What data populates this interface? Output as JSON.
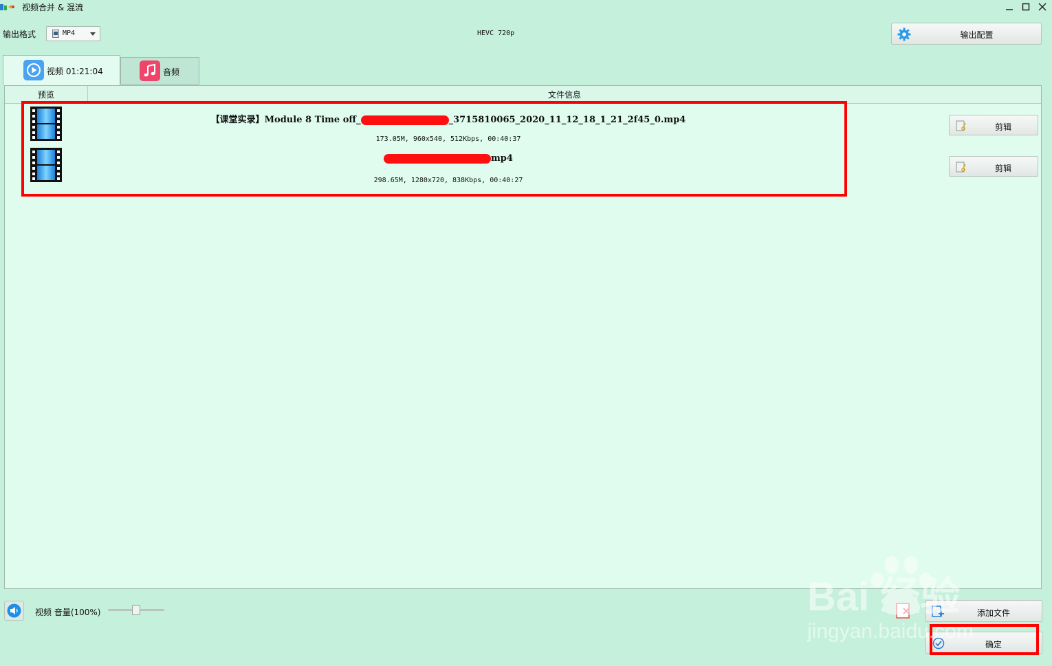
{
  "window": {
    "title": "视频合并 & 混流"
  },
  "toolbar": {
    "format_label": "输出格式",
    "format_value": "MP4",
    "codec_info": "HEVC 720p",
    "output_config_label": "输出配置"
  },
  "tabs": [
    {
      "label": "视频 01:21:04"
    },
    {
      "label": "音频"
    }
  ],
  "table": {
    "columns": [
      "预览",
      "文件信息"
    ],
    "rows": [
      {
        "name_prefix": "【课堂实录】Module 8 Time off_",
        "name_suffix": "_3715810065_2020_11_12_18_1_21_2f45_0.mp4",
        "details": "173.05M, 960x540, 512Kbps, 00:40:37",
        "trim_label": "剪辑"
      },
      {
        "name_prefix": "",
        "name_suffix": "mp4",
        "details": "298.65M, 1280x720, 838Kbps, 00:40:27",
        "trim_label": "剪辑"
      }
    ]
  },
  "bottom": {
    "volume_label": "视频 音量(100%)",
    "volume_fraction": 0.5,
    "add_file_label": "添加文件",
    "confirm_label": "确定"
  },
  "watermark": {
    "line1": "Bai 经验",
    "line2": "jingyan.baidu.com"
  },
  "colors": {
    "window_bg": "#c5f0dc",
    "panel_bg": "#dffcef",
    "highlight": "#ff0000",
    "accent_blue": "#4aa3f0",
    "accent_pink": "#f0456a"
  }
}
